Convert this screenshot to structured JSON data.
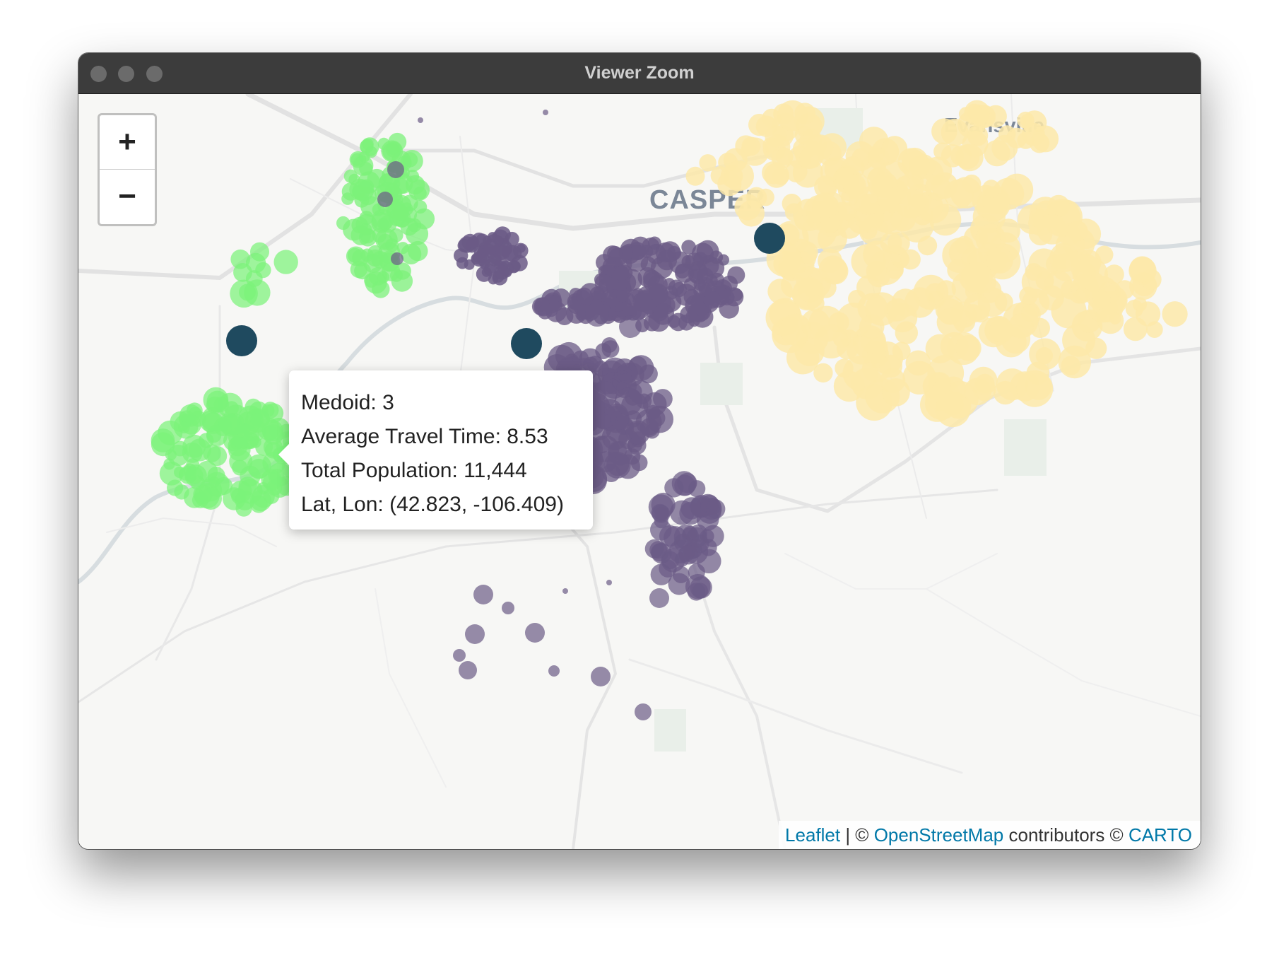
{
  "window": {
    "title": "Viewer Zoom"
  },
  "zoom_control": {
    "zoom_in_label": "+",
    "zoom_out_label": "−"
  },
  "map": {
    "base_layer": "CARTO light basemap",
    "place_labels": [
      {
        "text": "CASPER"
      },
      {
        "text": "Evansville"
      }
    ],
    "cluster_colors": {
      "medoid_marker": "#1f4a5f",
      "cluster_green": "#7cf27a",
      "cluster_purple": "#6b5b86",
      "cluster_yellow": "#fde9a9"
    }
  },
  "popup": {
    "line1": "Medoid: 3",
    "line2": "Average Travel Time: 8.53",
    "line3": "Total Population: 11,444",
    "line4": "Lat, Lon: (42.823, -106.409)"
  },
  "attribution": {
    "leaflet": "Leaflet",
    "sep1": " | © ",
    "osm": "OpenStreetMap",
    "middle": " contributors © ",
    "carto": "CARTO"
  }
}
